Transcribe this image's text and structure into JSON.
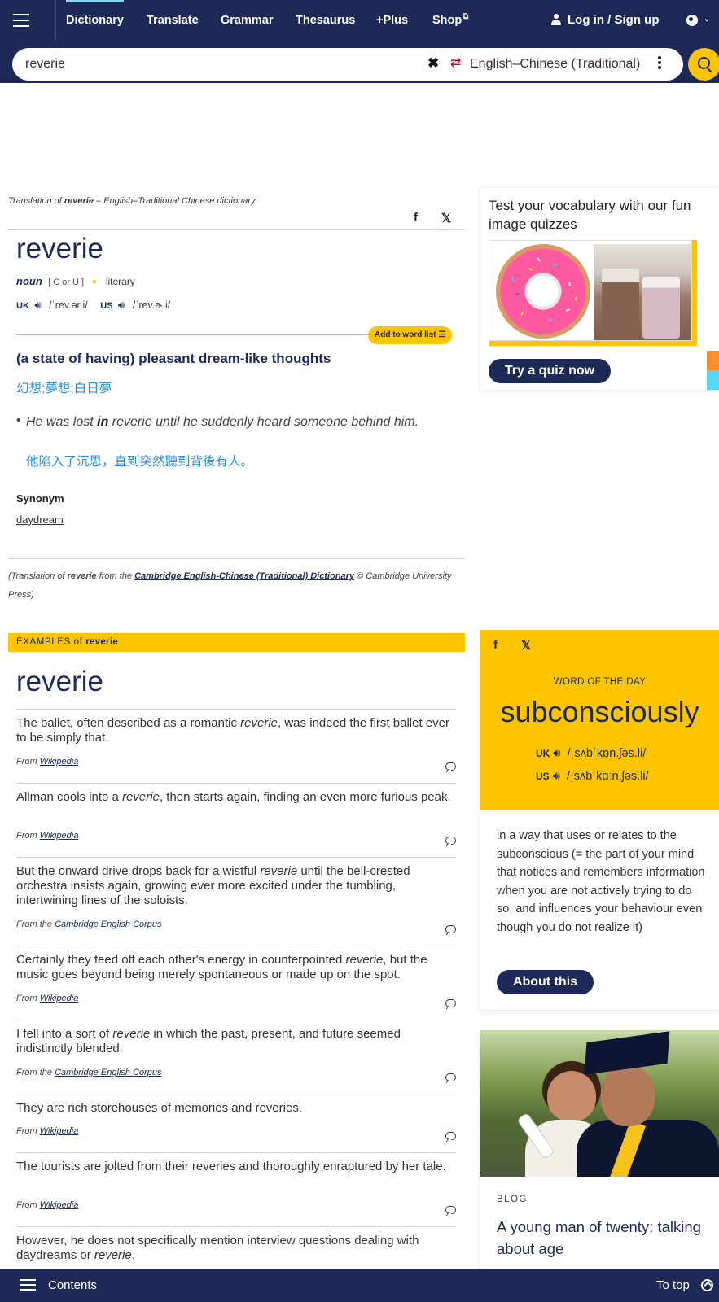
{
  "nav": {
    "items": [
      "Dictionary",
      "Translate",
      "Grammar",
      "Thesaurus",
      "+Plus",
      "Shop"
    ],
    "login": "Log in / Sign up"
  },
  "search": {
    "query": "reverie",
    "language": "English–Chinese (Traditional)"
  },
  "entry": {
    "caption_prefix": "Translation of ",
    "caption_word": "reverie",
    "caption_suffix": " – English–Traditional Chinese dictionary",
    "headword": "reverie",
    "pos": "noun",
    "grammar": "[ C or U ]",
    "usage": "literary",
    "uk_label": "UK",
    "uk_ipa": "/ˈrev.ər.i/",
    "us_label": "US",
    "us_ipa": "/ˈrev.ɚ.i/",
    "add_to_list": "Add to word list",
    "definition": "(a state of having) pleasant dream-like thoughts",
    "translation": "幻想;夢想;白日夢",
    "example_before": "He was lost ",
    "example_bold": "in",
    "example_after": " reverie until he suddenly heard someone behind him.",
    "example_translation": "他陷入了沉思，直到突然聽到背後有人。",
    "synonym_label": "Synonym",
    "synonym": "daydream",
    "credit_prefix": "(Translation of ",
    "credit_word": "reverie",
    "credit_middle": " from the ",
    "credit_source": "Cambridge English-Chinese (Traditional) Dictionary",
    "credit_suffix": " © Cambridge University Press)"
  },
  "quiz": {
    "title": "Test your vocabulary with our fun image quizzes",
    "button": "Try a quiz now"
  },
  "examples": {
    "bar_prefix": "EXAMPLES of ",
    "bar_word": "reverie",
    "heading": "reverie",
    "items": [
      {
        "before": "The ballet, often described as a romantic ",
        "word": "reverie",
        "after": ", was indeed the first ballet ever to be simply that.",
        "from": "From ",
        "source": "Wikipedia"
      },
      {
        "before": "Allman cools into a ",
        "word": "reverie",
        "after": ", then starts again, finding an even more furious peak.",
        "from": "From ",
        "source": "Wikipedia"
      },
      {
        "before": "But the onward drive drops back for a wistful ",
        "word": "reverie",
        "after": " until the bell-crested orchestra insists again, growing ever more excited under the tumbling, intertwining lines of the soloists.",
        "from": "From the ",
        "source": "Cambridge English Corpus"
      },
      {
        "before": "Certainly they feed off each other's energy in counterpointed ",
        "word": "reverie",
        "after": ", but the music goes beyond being merely spontaneous or made up on the spot.",
        "from": "From ",
        "source": "Wikipedia"
      },
      {
        "before": "I fell into a sort of ",
        "word": "reverie",
        "after": " in which the past, present, and future seemed indistinctly blended.",
        "from": "From the ",
        "source": "Cambridge English Corpus"
      },
      {
        "before": "They are rich storehouses of memories and reveries.",
        "word": "",
        "after": "",
        "from": "From ",
        "source": "Wikipedia"
      },
      {
        "before": "The tourists are jolted from their reveries and thoroughly enraptured by her tale.",
        "word": "",
        "after": "",
        "from": "From ",
        "source": "Wikipedia"
      },
      {
        "before": "However, he does not specifically mention interview questions dealing with daydreams or ",
        "word": "reverie",
        "after": ".",
        "from": "",
        "source": ""
      }
    ]
  },
  "wotd": {
    "label": "WORD OF THE DAY",
    "word": "subconsciously",
    "uk_label": "UK",
    "uk_ipa": "/ˌsʌbˈkɒn.ʃəs.li/",
    "us_label": "US",
    "us_ipa": "/ˌsʌbˈkɑːn.ʃəs.li/",
    "definition": "in a way that uses or relates to the subconscious (= the part of your mind that notices and remembers information when you are not actively trying to do so, and influences your behaviour even though you do not realize it)",
    "button": "About this"
  },
  "blog": {
    "label": "BLOG",
    "title": "A young man of twenty: talking about age"
  },
  "bottom": {
    "contents": "Contents",
    "to_top": "To top"
  },
  "colors": {
    "navy": "#1d2a57",
    "yellow": "#fec400",
    "translation_blue": "#2d8fdb"
  },
  "icons": [
    "menu-icon",
    "user-icon",
    "globe-icon",
    "clear-icon",
    "swap-icon",
    "more-icon",
    "search-icon",
    "facebook-icon",
    "x-icon",
    "speaker-icon",
    "list-icon",
    "comment-icon",
    "arrow-up-icon"
  ]
}
